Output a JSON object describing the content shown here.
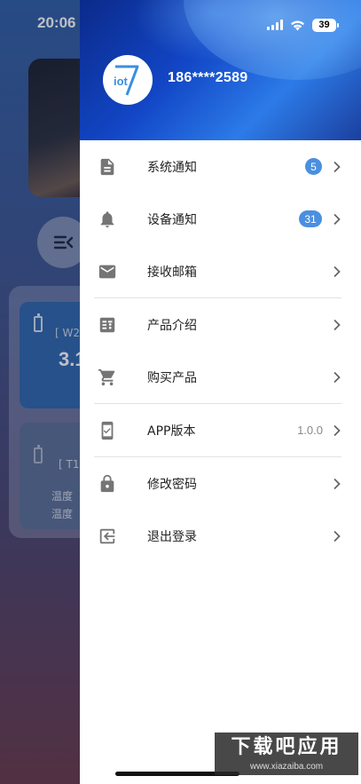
{
  "status_bar": {
    "time": "20:06",
    "battery": "39"
  },
  "background": {
    "card1_value": "3.1",
    "card1_code": "[ W2",
    "card2_code": "[ T1",
    "card2_line1": "温度",
    "card2_line2": "温度"
  },
  "drawer": {
    "avatar_text": "iot",
    "avatar_digit": "7",
    "phone": "186****2589",
    "menu": [
      {
        "label": "系统通知",
        "badge": "5",
        "icon": "notification-icon"
      },
      {
        "label": "设备通知",
        "badge": "31",
        "icon": "bell-icon"
      },
      {
        "label": "接收邮箱",
        "icon": "mail-icon"
      },
      {
        "label": "产品介绍",
        "icon": "list-icon"
      },
      {
        "label": "购买产品",
        "icon": "cart-icon"
      },
      {
        "label": "APP版本",
        "value": "1.0.0",
        "icon": "phone-check-icon"
      },
      {
        "label": "修改密码",
        "icon": "lock-icon"
      },
      {
        "label": "退出登录",
        "icon": "logout-icon"
      }
    ]
  },
  "watermark": {
    "title": "下载吧应用",
    "url": "www.xiazaiba.com"
  },
  "colors": {
    "badge": "#4a8fe0",
    "header": "#1246c6",
    "icon": "#757575"
  }
}
